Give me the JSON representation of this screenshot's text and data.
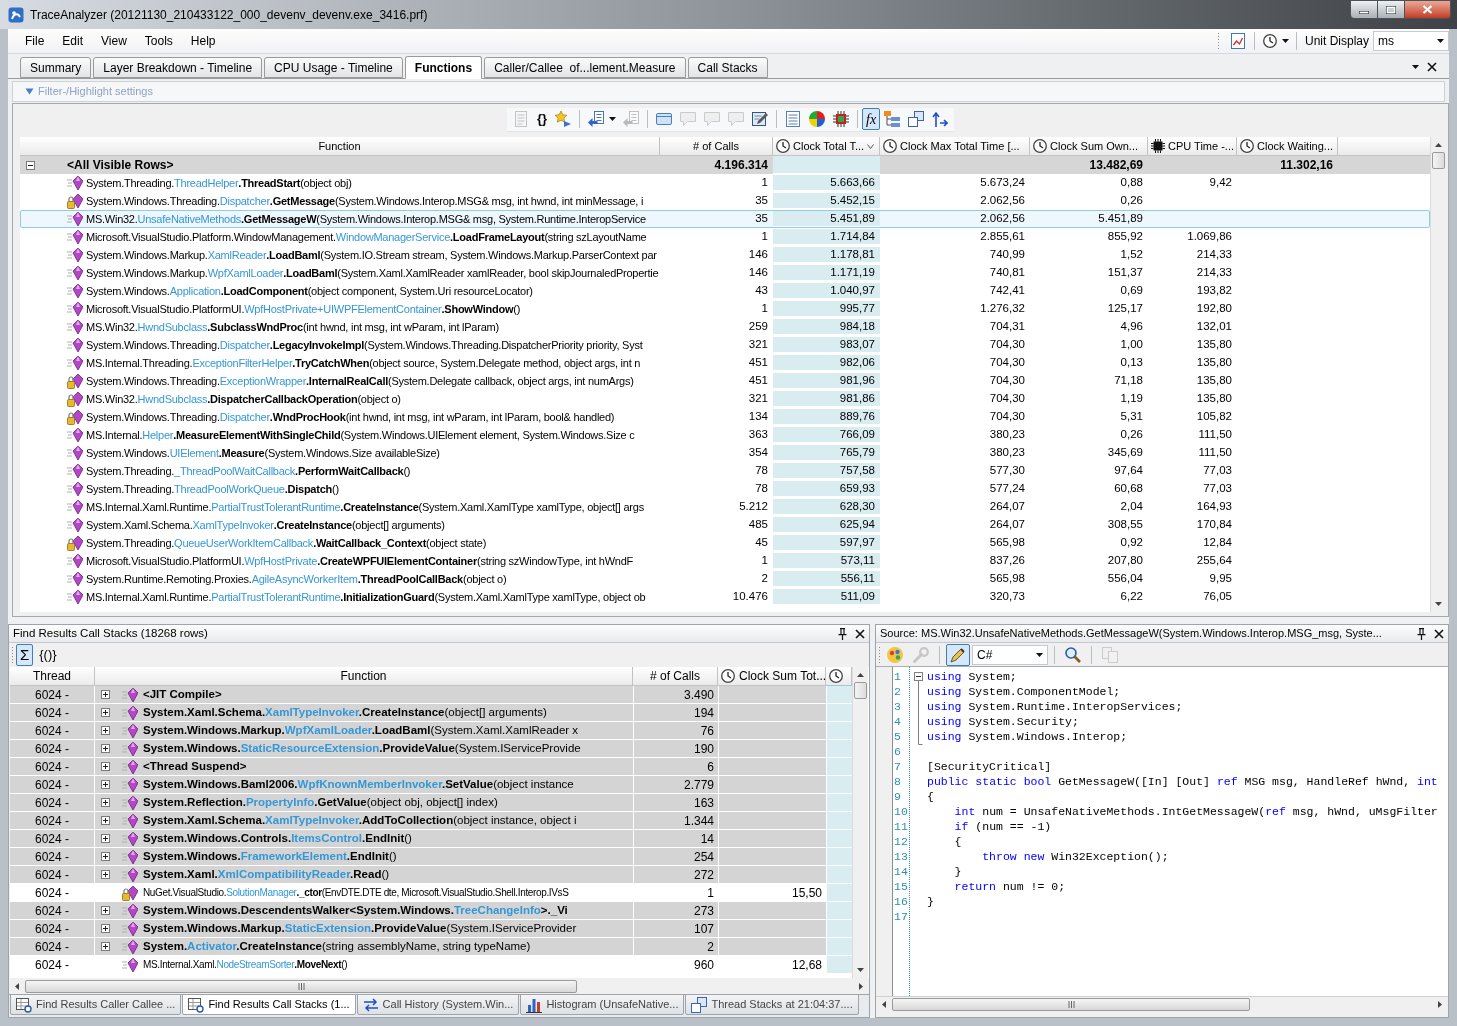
{
  "window": {
    "title": "TraceAnalyzer (20121130_210433122_000_devenv_devenv.exe_3416.prf)"
  },
  "menu": {
    "items": [
      "File",
      "Edit",
      "View",
      "Tools",
      "Help"
    ]
  },
  "menu_toolbar": {
    "items": [
      {
        "kind": "button",
        "disabled": false,
        "pressed": false
      },
      {
        "kind": "separator"
      },
      {
        "kind": "split_button",
        "disabled": false,
        "pressed": false
      },
      {
        "kind": "separator"
      },
      {
        "kind": "label",
        "text": "Unit Display"
      },
      {
        "kind": "combo",
        "value": "ms"
      }
    ]
  },
  "tabs": [
    {
      "label": "Summary",
      "selected": false
    },
    {
      "label": "Layer Breakdown - Timeline",
      "selected": false
    },
    {
      "label": "CPU Usage - Timeline",
      "selected": false
    },
    {
      "label": "Functions",
      "selected": true
    },
    {
      "label": "Caller/Callee  of...lement.Measure",
      "selected": false
    },
    {
      "label": "Call Stacks",
      "selected": false
    }
  ],
  "filter": {
    "label": "Filter-/Highlight settings"
  },
  "toolbar": {
    "items": [
      {
        "kind": "button",
        "disabled": true,
        "pressed": false
      },
      {
        "kind": "button",
        "label": "{}",
        "disabled": false,
        "pressed": false
      },
      {
        "kind": "button",
        "disabled": false,
        "pressed": false
      },
      {
        "kind": "separator"
      },
      {
        "kind": "split_button",
        "disabled": false,
        "pressed": false
      },
      {
        "kind": "button",
        "disabled": true,
        "pressed": false
      },
      {
        "kind": "separator"
      },
      {
        "kind": "button",
        "disabled": false,
        "pressed": false
      },
      {
        "kind": "button",
        "disabled": true,
        "pressed": false
      },
      {
        "kind": "button",
        "disabled": true,
        "pressed": false
      },
      {
        "kind": "button",
        "disabled": true,
        "pressed": false
      },
      {
        "kind": "button",
        "disabled": false,
        "pressed": false
      },
      {
        "kind": "separator"
      },
      {
        "kind": "button",
        "disabled": false,
        "pressed": false
      },
      {
        "kind": "button",
        "disabled": false,
        "pressed": false
      },
      {
        "kind": "button",
        "disabled": false,
        "pressed": false
      },
      {
        "kind": "separator"
      },
      {
        "kind": "button",
        "label": "fx",
        "disabled": false,
        "pressed": true
      },
      {
        "kind": "button",
        "disabled": false,
        "pressed": false
      },
      {
        "kind": "button",
        "disabled": false,
        "pressed": false
      },
      {
        "kind": "button",
        "disabled": false,
        "pressed": false
      }
    ]
  },
  "functions_table": {
    "columns": [
      {
        "label": "Function",
        "kind": "text",
        "sorted": false
      },
      {
        "label": "# of Calls",
        "kind": "count",
        "sorted": false
      },
      {
        "label": "Clock Total T...",
        "kind": "clock",
        "sorted": true
      },
      {
        "label": "Clock Max Total Time [...",
        "kind": "clock",
        "sorted": false
      },
      {
        "label": "Clock Sum Own...",
        "kind": "clock",
        "sorted": false
      },
      {
        "label": "CPU Time -...",
        "kind": "cpu",
        "sorted": false
      },
      {
        "label": "Clock Waiting...",
        "kind": "clock",
        "sorted": false
      }
    ],
    "summary": {
      "label": "<All Visible Rows>",
      "expanded": true,
      "calls": "4.196.314",
      "clock_sum_own": "13.482,69",
      "clock_waiting": "11.302,16"
    },
    "rows": [
      {
        "selected": false,
        "locked": false,
        "namespace": "System.Threading.",
        "class": "ThreadHelper",
        "method": ".ThreadStart",
        "params": "(object obj)",
        "calls": "1",
        "clock_total": "5.663,66",
        "clock_max_total": "5.673,24",
        "clock_sum_own": "0,88",
        "cpu_time": "9,42"
      },
      {
        "selected": false,
        "locked": true,
        "namespace": "System.Windows.Threading.",
        "class": "Dispatcher",
        "method": ".GetMessage",
        "params": "(System.Windows.Interop.MSG& msg, int hwnd, int minMessage, i",
        "calls": "35",
        "clock_total": "5.452,15",
        "clock_max_total": "2.062,56",
        "clock_sum_own": "0,26"
      },
      {
        "selected": true,
        "locked": false,
        "namespace": "MS.Win32.",
        "class": "UnsafeNativeMethods",
        "method": ".GetMessageW",
        "params": "(System.Windows.Interop.MSG& msg, System.Runtime.InteropService",
        "calls": "35",
        "clock_total": "5.451,89",
        "clock_max_total": "2.062,56",
        "clock_sum_own": "5.451,89"
      },
      {
        "selected": false,
        "locked": false,
        "namespace": "Microsoft.VisualStudio.Platform.WindowManagement.",
        "class": "WindowManagerService",
        "method": ".LoadFrameLayout",
        "params": "(string szLayoutName",
        "calls": "1",
        "clock_total": "1.714,84",
        "clock_max_total": "2.855,61",
        "clock_sum_own": "855,92",
        "cpu_time": "1.069,86"
      },
      {
        "selected": false,
        "locked": false,
        "namespace": "System.Windows.Markup.",
        "class": "XamlReader",
        "method": ".LoadBaml",
        "params": "(System.IO.Stream stream, System.Windows.Markup.ParserContext par",
        "calls": "146",
        "clock_total": "1.178,81",
        "clock_max_total": "740,99",
        "clock_sum_own": "1,52",
        "cpu_time": "214,33"
      },
      {
        "selected": false,
        "locked": false,
        "namespace": "System.Windows.Markup.",
        "class": "WpfXamlLoader",
        "method": ".LoadBaml",
        "params": "(System.Xaml.XamlReader xamlReader, bool skipJournaledPropertie",
        "calls": "146",
        "clock_total": "1.171,19",
        "clock_max_total": "740,81",
        "clock_sum_own": "151,37",
        "cpu_time": "214,33"
      },
      {
        "selected": false,
        "locked": false,
        "namespace": "System.Windows.",
        "class": "Application",
        "method": ".LoadComponent",
        "params": "(object component, System.Uri resourceLocator)",
        "calls": "43",
        "clock_total": "1.040,97",
        "clock_max_total": "742,41",
        "clock_sum_own": "0,69",
        "cpu_time": "193,82"
      },
      {
        "selected": false,
        "locked": false,
        "namespace": "Microsoft.VisualStudio.PlatformUI.",
        "class": "WpfHostPrivate+UIWPFElementContainer",
        "method": ".ShowWindow",
        "params": "()",
        "calls": "1",
        "clock_total": "995,77",
        "clock_max_total": "1.276,32",
        "clock_sum_own": "125,17",
        "cpu_time": "192,80"
      },
      {
        "selected": false,
        "locked": false,
        "namespace": "MS.Win32.",
        "class": "HwndSubclass",
        "method": ".SubclassWndProc",
        "params": "(int hwnd, int msg, int wParam, int lParam)",
        "calls": "259",
        "clock_total": "984,18",
        "clock_max_total": "704,31",
        "clock_sum_own": "4,96",
        "cpu_time": "132,01"
      },
      {
        "selected": false,
        "locked": false,
        "namespace": "System.Windows.Threading.",
        "class": "Dispatcher",
        "method": ".LegacyInvokeImpl",
        "params": "(System.Windows.Threading.DispatcherPriority priority, Syst",
        "calls": "321",
        "clock_total": "983,07",
        "clock_max_total": "704,30",
        "clock_sum_own": "1,00",
        "cpu_time": "135,80"
      },
      {
        "selected": false,
        "locked": false,
        "namespace": "MS.Internal.Threading.",
        "class": "ExceptionFilterHelper",
        "method": ".TryCatchWhen",
        "params": "(object source, System.Delegate method, object args, int n",
        "calls": "451",
        "clock_total": "982,06",
        "clock_max_total": "704,30",
        "clock_sum_own": "0,13",
        "cpu_time": "135,80"
      },
      {
        "selected": false,
        "locked": true,
        "namespace": "System.Windows.Threading.",
        "class": "ExceptionWrapper",
        "method": ".InternalRealCall",
        "params": "(System.Delegate callback, object args, int numArgs)",
        "calls": "451",
        "clock_total": "981,96",
        "clock_max_total": "704,30",
        "clock_sum_own": "71,18",
        "cpu_time": "135,80"
      },
      {
        "selected": false,
        "locked": true,
        "namespace": "MS.Win32.",
        "class": "HwndSubclass",
        "method": ".DispatcherCallbackOperation",
        "params": "(object o)",
        "calls": "321",
        "clock_total": "981,86",
        "clock_max_total": "704,30",
        "clock_sum_own": "1,19",
        "cpu_time": "135,80"
      },
      {
        "selected": false,
        "locked": true,
        "namespace": "System.Windows.Threading.",
        "class": "Dispatcher",
        "method": ".WndProcHook",
        "params": "(int hwnd, int msg, int wParam, int lParam, bool& handled)",
        "calls": "134",
        "clock_total": "889,76",
        "clock_max_total": "704,30",
        "clock_sum_own": "5,31",
        "cpu_time": "105,82"
      },
      {
        "selected": false,
        "locked": false,
        "namespace": "MS.Internal.",
        "class": "Helper",
        "method": ".MeasureElementWithSingleChild",
        "params": "(System.Windows.UIElement element, System.Windows.Size c",
        "calls": "363",
        "clock_total": "766,09",
        "clock_max_total": "380,23",
        "clock_sum_own": "0,26",
        "cpu_time": "111,50"
      },
      {
        "selected": false,
        "locked": false,
        "namespace": "System.Windows.",
        "class": "UIElement",
        "method": ".Measure",
        "params": "(System.Windows.Size availableSize)",
        "calls": "354",
        "clock_total": "765,79",
        "clock_max_total": "380,23",
        "clock_sum_own": "345,69",
        "cpu_time": "111,50"
      },
      {
        "selected": false,
        "locked": false,
        "namespace": "System.Threading.",
        "class": "_ThreadPoolWaitCallback",
        "method": ".PerformWaitCallback",
        "params": "()",
        "calls": "78",
        "clock_total": "757,58",
        "clock_max_total": "577,30",
        "clock_sum_own": "97,64",
        "cpu_time": "77,03"
      },
      {
        "selected": false,
        "locked": false,
        "namespace": "System.Threading.",
        "class": "ThreadPoolWorkQueue",
        "method": ".Dispatch",
        "params": "()",
        "calls": "78",
        "clock_total": "659,93",
        "clock_max_total": "577,24",
        "clock_sum_own": "60,68",
        "cpu_time": "77,03"
      },
      {
        "selected": false,
        "locked": false,
        "namespace": "MS.Internal.Xaml.Runtime.",
        "class": "PartialTrustTolerantRuntime",
        "method": ".CreateInstance",
        "params": "(System.Xaml.XamlType xamlType, object[] args",
        "calls": "5.212",
        "clock_total": "628,30",
        "clock_max_total": "264,07",
        "clock_sum_own": "2,04",
        "cpu_time": "164,93"
      },
      {
        "selected": false,
        "locked": false,
        "namespace": "System.Xaml.Schema.",
        "class": "XamlTypeInvoker",
        "method": ".CreateInstance",
        "params": "(object[] arguments)",
        "calls": "485",
        "clock_total": "625,94",
        "clock_max_total": "264,07",
        "clock_sum_own": "308,55",
        "cpu_time": "170,84"
      },
      {
        "selected": false,
        "locked": true,
        "namespace": "System.Threading.",
        "class": "QueueUserWorkItemCallback",
        "method": ".WaitCallback_Context",
        "params": "(object state)",
        "calls": "45",
        "clock_total": "597,97",
        "clock_max_total": "565,98",
        "clock_sum_own": "0,92",
        "cpu_time": "12,84"
      },
      {
        "selected": false,
        "locked": false,
        "namespace": "Microsoft.VisualStudio.PlatformUI.",
        "class": "WpfHostPrivate",
        "method": ".CreateWPFUIElementContainer",
        "params": "(string szWindowType, int hWndF",
        "calls": "1",
        "clock_total": "573,11",
        "clock_max_total": "837,26",
        "clock_sum_own": "207,80",
        "cpu_time": "255,64"
      },
      {
        "selected": false,
        "locked": false,
        "namespace": "System.Runtime.Remoting.Proxies.",
        "class": "AgileAsyncWorkerItem",
        "method": ".ThreadPoolCallBack",
        "params": "(object o)",
        "calls": "2",
        "clock_total": "556,11",
        "clock_max_total": "565,98",
        "clock_sum_own": "556,04",
        "cpu_time": "9,95"
      },
      {
        "selected": false,
        "locked": false,
        "namespace": "MS.Internal.Xaml.Runtime.",
        "class": "PartialTrustTolerantRuntime",
        "method": ".InitializationGuard",
        "params": "(System.Xaml.XamlType xamlType, object ob",
        "calls": "10.476",
        "clock_total": "511,09",
        "clock_max_total": "320,73",
        "clock_sum_own": "6,22",
        "cpu_time": "76,05"
      }
    ]
  },
  "call_stacks_panel": {
    "title": "Find Results Call Stacks (18268 rows)",
    "toolbar": {
      "items": [
        {
          "kind": "button",
          "label": "Σ",
          "disabled": false,
          "pressed": true
        },
        {
          "kind": "button",
          "label": "{()}",
          "disabled": false,
          "pressed": false
        }
      ]
    },
    "columns": [
      {
        "label": "Thread",
        "kind": "text",
        "sorted": false
      },
      {
        "label": "Function",
        "kind": "text",
        "sorted": false
      },
      {
        "label": "# of Calls",
        "kind": "count",
        "sorted": false
      },
      {
        "label": "Clock Sum Tot...",
        "kind": "clock",
        "sorted": false
      },
      {
        "kind": "clock",
        "sorted": true
      }
    ],
    "rows": [
      {
        "kind": "group",
        "expanded": false,
        "locked": false,
        "thread": "6024 -",
        "method": "<JIT Compile>",
        "calls": "3.490"
      },
      {
        "kind": "group",
        "expanded": false,
        "locked": false,
        "thread": "6024 -",
        "namespace": "System.Xaml.Schema.",
        "class": "XamlTypeInvoker",
        "method": ".CreateInstance",
        "params": "(object[] arguments)",
        "calls": "194"
      },
      {
        "kind": "group",
        "expanded": false,
        "locked": false,
        "thread": "6024 -",
        "namespace": "System.Windows.Markup.",
        "class": "WpfXamlLoader",
        "method": ".LoadBaml",
        "params": "(System.Xaml.XamlReader x",
        "calls": "76"
      },
      {
        "kind": "group",
        "expanded": false,
        "locked": false,
        "thread": "6024 -",
        "namespace": "System.Windows.",
        "class": "StaticResourceExtension",
        "method": ".ProvideValue",
        "params": "(System.IServiceProvide",
        "calls": "190"
      },
      {
        "kind": "group",
        "expanded": false,
        "locked": false,
        "thread": "6024 -",
        "method": "<Thread Suspend>",
        "calls": "6"
      },
      {
        "kind": "group",
        "expanded": false,
        "locked": false,
        "thread": "6024 -",
        "namespace": "System.Windows.Baml2006.",
        "class": "WpfKnownMemberInvoker",
        "method": ".SetValue",
        "params": "(object instance",
        "calls": "2.779"
      },
      {
        "kind": "group",
        "expanded": false,
        "locked": false,
        "thread": "6024 -",
        "namespace": "System.Reflection.",
        "class": "PropertyInfo",
        "method": ".GetValue",
        "params": "(object obj, object[] index)",
        "calls": "163"
      },
      {
        "kind": "group",
        "expanded": false,
        "locked": false,
        "thread": "6024 -",
        "namespace": "System.Xaml.Schema.",
        "class": "XamlTypeInvoker",
        "method": ".AddToCollection",
        "params": "(object instance, object i",
        "calls": "1.344"
      },
      {
        "kind": "group",
        "expanded": false,
        "locked": false,
        "thread": "6024 -",
        "namespace": "System.Windows.Controls.",
        "class": "ItemsControl",
        "method": ".EndInit",
        "params": "()",
        "calls": "14"
      },
      {
        "kind": "group",
        "expanded": false,
        "locked": false,
        "thread": "6024 -",
        "namespace": "System.Windows.",
        "class": "FrameworkElement",
        "method": ".EndInit",
        "params": "()",
        "calls": "254"
      },
      {
        "kind": "group",
        "expanded": false,
        "locked": false,
        "thread": "6024 -",
        "namespace": "System.Xaml.",
        "class": "XmlCompatibilityReader",
        "method": ".Read",
        "params": "()",
        "calls": "272"
      },
      {
        "kind": "leaf",
        "locked": true,
        "thread": "6024 -",
        "namespace": "NuGet.VisualStudio.",
        "class": "SolutionManager",
        "method": "._ctor",
        "params": "(EnvDTE.DTE dte, Microsoft.VisualStudio.Shell.Interop.IVsS",
        "calls": "1",
        "clock_sum_total": "15,50"
      },
      {
        "kind": "group",
        "expanded": false,
        "locked": false,
        "thread": "6024 -",
        "generic_prefix": "System.Windows.DescendentsWalker<System.Windows.",
        "type_argument": "TreeChangeInfo",
        "generic_suffix": ">._Vi",
        "calls": "273"
      },
      {
        "kind": "group",
        "expanded": false,
        "locked": false,
        "thread": "6024 -",
        "namespace": "System.Windows.Markup.",
        "class": "StaticExtension",
        "method": ".ProvideValue",
        "params": "(System.IServiceProvider",
        "calls": "107"
      },
      {
        "kind": "group",
        "expanded": false,
        "locked": false,
        "thread": "6024 -",
        "namespace": "System.",
        "class": "Activator",
        "method": ".CreateInstance",
        "params": "(string assemblyName, string typeName)",
        "calls": "2"
      },
      {
        "kind": "leaf",
        "locked": false,
        "thread": "6024 -",
        "namespace": "MS.Internal.Xaml.",
        "class": "NodeStreamSorter",
        "method": ".MoveNext",
        "params": "()",
        "calls": "960",
        "clock_sum_total": "12,68"
      }
    ]
  },
  "source_panel": {
    "title": "Source: MS.Win32.UnsafeNativeMethods.GetMessageW(System.Windows.Interop.MSG_msg, Syste...",
    "toolbar": {
      "items": [
        {
          "kind": "button",
          "disabled": false,
          "pressed": false
        },
        {
          "kind": "button",
          "disabled": true,
          "pressed": false
        },
        {
          "kind": "separator"
        },
        {
          "kind": "button",
          "disabled": false,
          "pressed": true
        },
        {
          "kind": "combo",
          "value": "C#"
        },
        {
          "kind": "separator"
        },
        {
          "kind": "button",
          "disabled": false,
          "pressed": false
        },
        {
          "kind": "separator"
        },
        {
          "kind": "button",
          "disabled": true,
          "pressed": false
        }
      ]
    },
    "fold": {
      "expanded": true
    },
    "lines": [
      {
        "number": "1",
        "tokens": [
          {
            "keyword": "using"
          },
          {
            "text": " System;"
          }
        ]
      },
      {
        "number": "2",
        "tokens": [
          {
            "keyword": "using"
          },
          {
            "text": " System.ComponentModel;"
          }
        ]
      },
      {
        "number": "3",
        "tokens": [
          {
            "keyword": "using"
          },
          {
            "text": " System.Runtime.InteropServices;"
          }
        ]
      },
      {
        "number": "4",
        "tokens": [
          {
            "keyword": "using"
          },
          {
            "text": " System.Security;"
          }
        ]
      },
      {
        "number": "5",
        "tokens": [
          {
            "keyword": "using"
          },
          {
            "text": " System.Windows.Interop;"
          }
        ]
      },
      {
        "number": "6"
      },
      {
        "number": "7",
        "tokens": [
          {
            "text": "[SecurityCritical]"
          }
        ]
      },
      {
        "number": "8",
        "tokens": [
          {
            "keyword": "public"
          },
          {
            "keyword": " static"
          },
          {
            "keyword": " bool"
          },
          {
            "text": " GetMessageW([In] [Out] "
          },
          {
            "keyword": "ref"
          },
          {
            "text": " MSG msg, HandleRef hWnd, "
          },
          {
            "keyword": "int"
          }
        ]
      },
      {
        "number": "9",
        "tokens": [
          {
            "text": "{"
          }
        ]
      },
      {
        "number": "10",
        "tokens": [
          {
            "keyword": "    int"
          },
          {
            "text": " num = UnsafeNativeMethods.IntGetMessageW("
          },
          {
            "keyword": "ref"
          },
          {
            "text": " msg, hWnd, uMsgFilter"
          }
        ]
      },
      {
        "number": "11",
        "tokens": [
          {
            "keyword": "    if"
          },
          {
            "text": " (num == -1)"
          }
        ]
      },
      {
        "number": "12",
        "tokens": [
          {
            "text": "    {"
          }
        ]
      },
      {
        "number": "13",
        "tokens": [
          {
            "keyword": "        throw"
          },
          {
            "keyword": " new"
          },
          {
            "text": " Win32Exception();"
          }
        ]
      },
      {
        "number": "14",
        "tokens": [
          {
            "text": "    }"
          }
        ]
      },
      {
        "number": "15",
        "tokens": [
          {
            "keyword": "    return"
          },
          {
            "text": " num != 0;"
          }
        ]
      },
      {
        "number": "16",
        "tokens": [
          {
            "text": "}"
          }
        ]
      },
      {
        "number": "17"
      }
    ]
  },
  "bottom_tabs": [
    {
      "label": "Find Results Caller Callee ...",
      "selected": false
    },
    {
      "label": "Find Results Call Stacks (1...",
      "selected": true
    },
    {
      "label": "Call History (System.Win...",
      "selected": false
    },
    {
      "label": "Histogram (UnsafeNative...",
      "selected": false
    },
    {
      "label": "Thread Stacks at 21:04:37....",
      "selected": false
    }
  ]
}
